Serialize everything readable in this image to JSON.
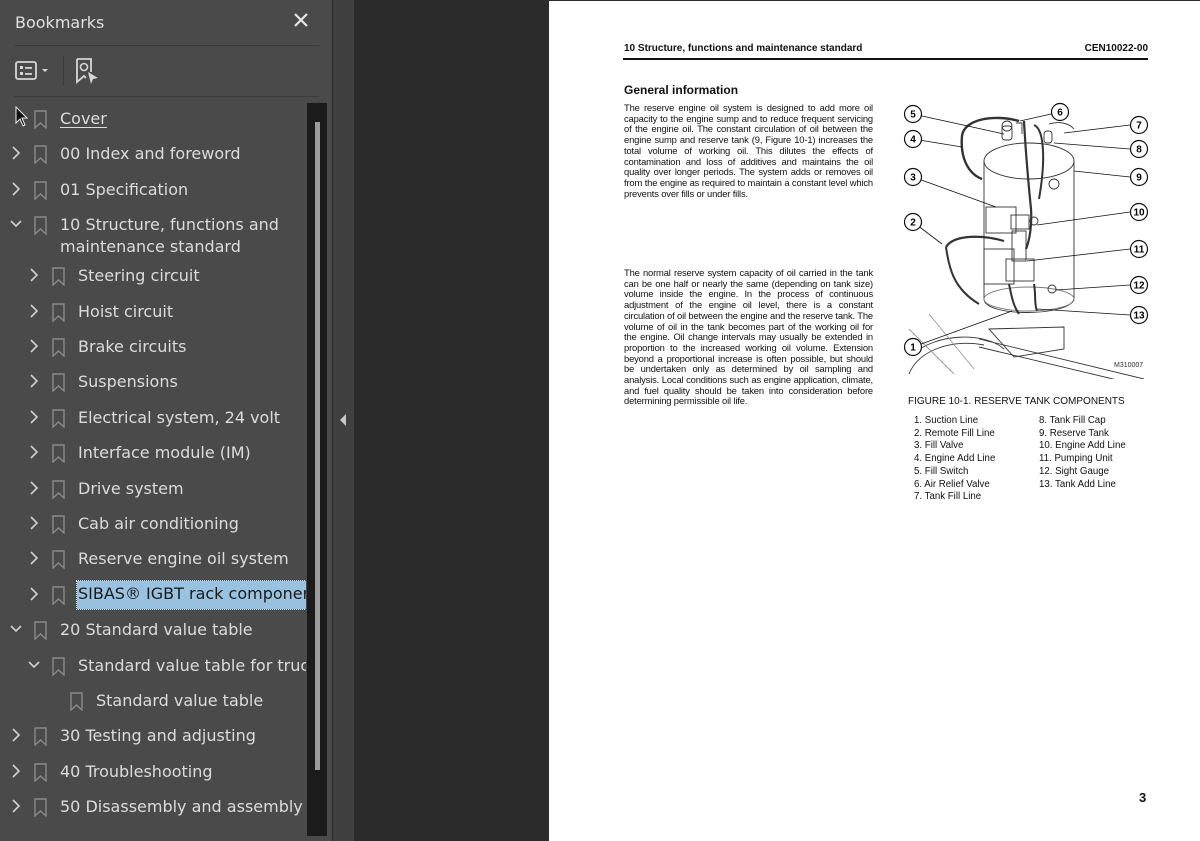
{
  "sidebar": {
    "title": "Bookmarks",
    "close_icon": "close-icon",
    "toolbar": {
      "options_button_icon": "list-options-icon",
      "find_current_bookmark_icon": "bookmark-locate-icon"
    },
    "items": [
      {
        "label": "Cover",
        "level": 0,
        "expander": "none",
        "underlined": true
      },
      {
        "label": "00 Index and foreword",
        "level": 0,
        "expander": "collapsed"
      },
      {
        "label": "01 Specification",
        "level": 0,
        "expander": "collapsed"
      },
      {
        "label": "10 Structure, functions and",
        "label_line2": "maintenance standard",
        "level": 0,
        "expander": "expanded"
      },
      {
        "label": "Steering circuit",
        "level": 1,
        "expander": "collapsed"
      },
      {
        "label": "Hoist circuit",
        "level": 1,
        "expander": "collapsed"
      },
      {
        "label": "Brake circuits",
        "level": 1,
        "expander": "collapsed"
      },
      {
        "label": "Suspensions",
        "level": 1,
        "expander": "collapsed"
      },
      {
        "label": "Electrical system, 24 volt",
        "level": 1,
        "expander": "collapsed"
      },
      {
        "label": "Interface module (IM)",
        "level": 1,
        "expander": "collapsed"
      },
      {
        "label": "Drive system",
        "level": 1,
        "expander": "collapsed"
      },
      {
        "label": "Cab air conditioning",
        "level": 1,
        "expander": "collapsed"
      },
      {
        "label": "Reserve engine oil system",
        "level": 1,
        "expander": "collapsed"
      },
      {
        "label": "SIBAS® IGBT rack components",
        "level": 1,
        "expander": "collapsed",
        "selected": true
      },
      {
        "label": "20 Standard value table",
        "level": 0,
        "expander": "expanded"
      },
      {
        "label": "Standard value table for truck",
        "level": 1,
        "expander": "expanded"
      },
      {
        "label": "Standard value table",
        "level": 2,
        "expander": "none"
      },
      {
        "label": "30 Testing and adjusting",
        "level": 0,
        "expander": "collapsed"
      },
      {
        "label": "40 Troubleshooting",
        "level": 0,
        "expander": "collapsed"
      },
      {
        "label": "50 Disassembly and assembly",
        "level": 0,
        "expander": "collapsed"
      }
    ],
    "selection_color": "#99c2e0"
  },
  "document": {
    "header_left": "10 Structure, functions and maintenance standard",
    "header_right": "CEN10022-00",
    "section_title": "General information",
    "paragraph1": "The reserve engine oil system is designed to add more oil capacity to the engine sump and to reduce frequent servicing of the engine oil. The constant circulation of oil between the engine sump and reserve tank (9, Figure 10-1) increases the total volume of working oil. This dilutes the effects of contamination and loss of additives and maintains the oil quality over longer periods. The system adds or removes oil from the engine as required to maintain a constant level which prevents over fills or under fills.",
    "paragraph2": "The normal reserve system capacity of oil carried in the tank can be one half or nearly the same (depending on tank size) volume inside the engine. In the process of continuous adjustment of the engine oil level, there is a constant circulation of oil between the engine and the reserve tank. The volume of oil in the tank becomes part of the working oil for the engine. Oil change intervals may usually be extended in proportion to the increased working oil volume. Extension beyond a proportional increase is often possible, but should be undertaken only as determined by oil sampling and analysis. Local conditions such as engine application, climate, and fuel quality should be taken into consideration before determining permissible oil life.",
    "figure": {
      "image_id": "M310007",
      "caption": "FIGURE 10-1. RESERVE TANK COMPONENTS",
      "callouts": [
        "1",
        "2",
        "3",
        "4",
        "5",
        "6",
        "7",
        "8",
        "9",
        "10",
        "11",
        "12",
        "13"
      ],
      "legend_col1": [
        "1. Suction Line",
        "2. Remote Fill Line",
        "3. Fill Valve",
        "4. Engine Add Line",
        "5. Fill Switch",
        "6. Air Relief Valve",
        "7. Tank Fill Line"
      ],
      "legend_col2": [
        "8. Tank Fill Cap",
        "9. Reserve Tank",
        "10. Engine Add Line",
        "11. Pumping Unit",
        "12. Sight Gauge",
        "13. Tank Add Line"
      ]
    },
    "page_number": "3"
  }
}
